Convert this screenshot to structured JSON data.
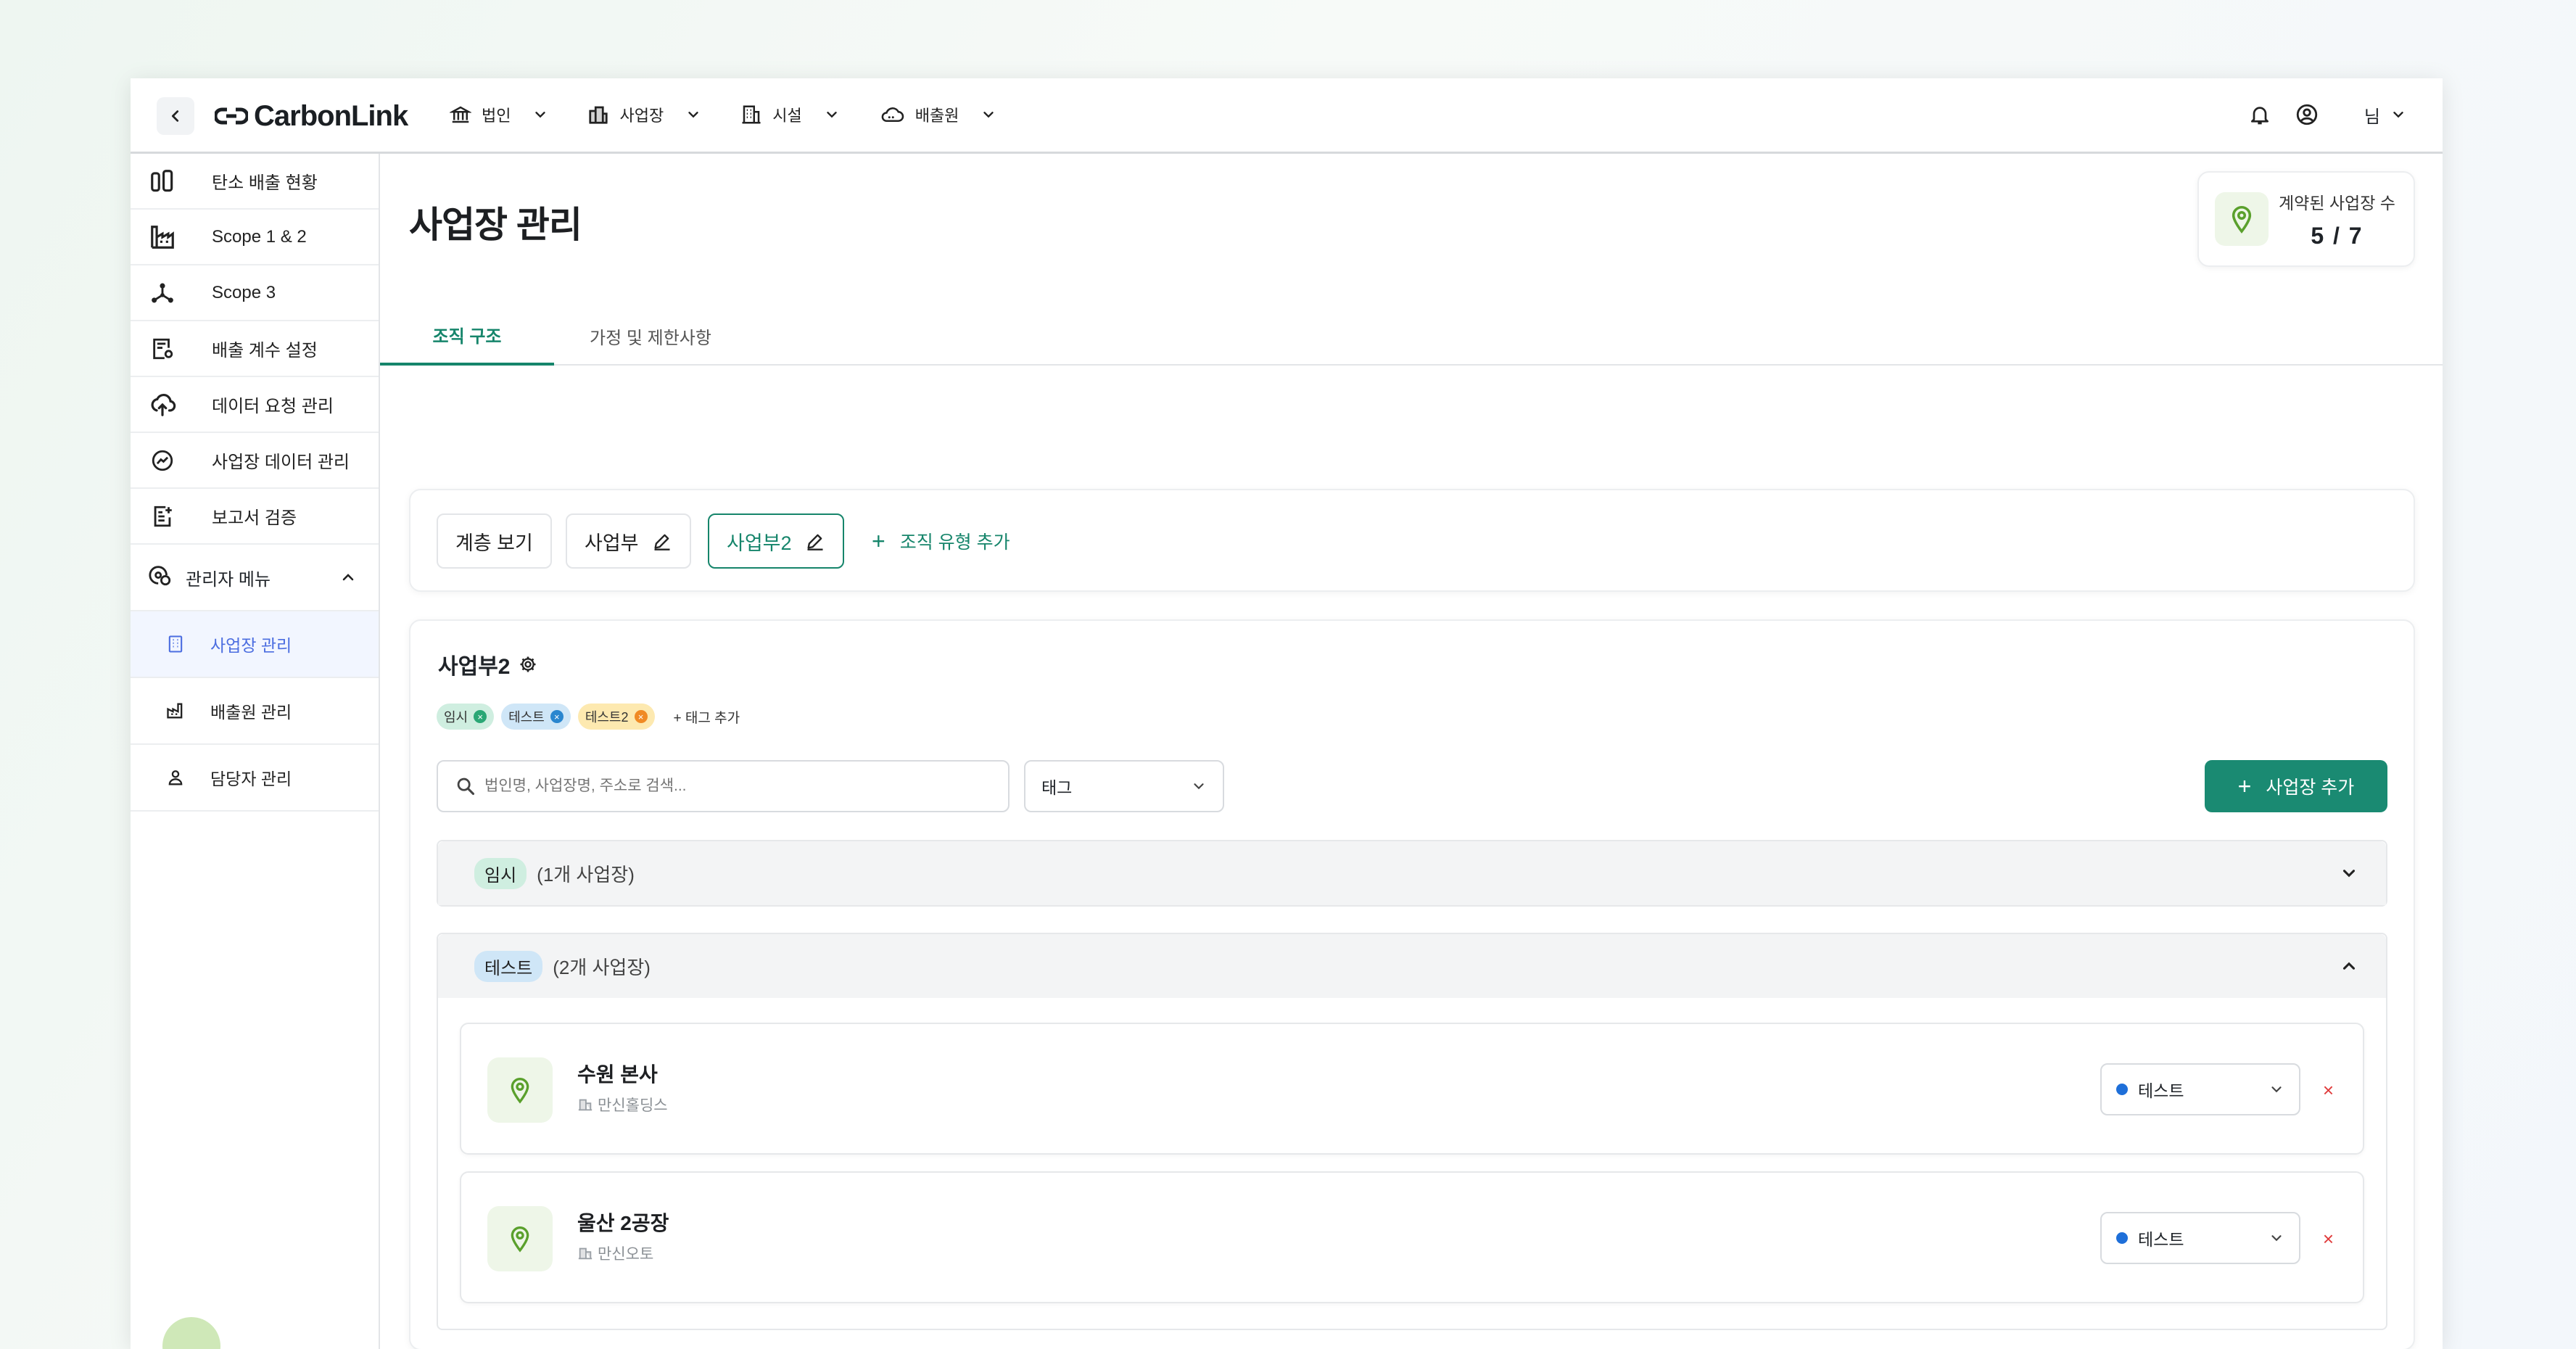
{
  "header": {
    "logo_text": "CarbonLink",
    "nav": [
      {
        "label": "법인",
        "icon": "building-columns-icon"
      },
      {
        "label": "사업장",
        "icon": "buildings-icon"
      },
      {
        "label": "시설",
        "icon": "building-icon"
      },
      {
        "label": "배출원",
        "icon": "cloud-icon"
      }
    ],
    "user_label": "님"
  },
  "sidebar": {
    "items": [
      {
        "label": "탄소 배출 현황",
        "icon": "bar-columns-icon"
      },
      {
        "label": "Scope 1 & 2",
        "icon": "factory-icon"
      },
      {
        "label": "Scope 3",
        "icon": "network-icon"
      },
      {
        "label": "배출 계수 설정",
        "icon": "document-gear-icon"
      },
      {
        "label": "데이터 요청 관리",
        "icon": "cloud-upload-icon"
      },
      {
        "label": "사업장 데이터 관리",
        "icon": "trend-icon"
      },
      {
        "label": "보고서 검증",
        "icon": "report-icon"
      }
    ],
    "admin_label": "관리자 메뉴",
    "sub_items": [
      {
        "label": "사업장 관리",
        "icon": "building-outline-icon",
        "active": true
      },
      {
        "label": "배출원 관리",
        "icon": "factory-small-icon",
        "active": false
      },
      {
        "label": "담당자 관리",
        "icon": "person-icon",
        "active": false
      }
    ]
  },
  "main": {
    "title": "사업장 관리",
    "contract_label": "계약된 사업장 수",
    "contract_value": "5 / 7",
    "tabs": [
      {
        "label": "조직 구조",
        "active": true
      },
      {
        "label": "가정 및 제한사항",
        "active": false
      }
    ],
    "org_chips": [
      "계층 보기",
      "사업부",
      "사업부2"
    ],
    "add_org_type": "조직 유형 추가",
    "division": {
      "title": "사업부2",
      "tags": [
        {
          "label": "임시",
          "bg": "#cfeee0",
          "x": "#2aa775"
        },
        {
          "label": "테스트",
          "bg": "#cfe6f7",
          "x": "#2a86cf"
        },
        {
          "label": "테스트2",
          "bg": "#fde9b0",
          "x": "#f08a24"
        }
      ],
      "tag_add": "태그 추가",
      "search_placeholder": "법인명, 사업장명, 주소로 검색...",
      "tag_select": "태그",
      "add_site": "사업장 추가",
      "groups": [
        {
          "tag": "임시",
          "count": "(1개 사업장)",
          "tag_bg": "#cfeee0",
          "expanded": false
        },
        {
          "tag": "테스트",
          "count": "(2개 사업장)",
          "tag_bg": "#cfe6f7",
          "expanded": true
        }
      ],
      "sites": [
        {
          "name": "수원 본사",
          "company": "만신홀딩스",
          "tag": "테스트"
        },
        {
          "name": "울산 2공장",
          "company": "만신오토",
          "tag": "테스트"
        }
      ]
    }
  },
  "colors": {
    "accent": "#16856b",
    "button": "#1a8a72",
    "danger": "#e03b3b",
    "pin": "#5aa02c"
  }
}
